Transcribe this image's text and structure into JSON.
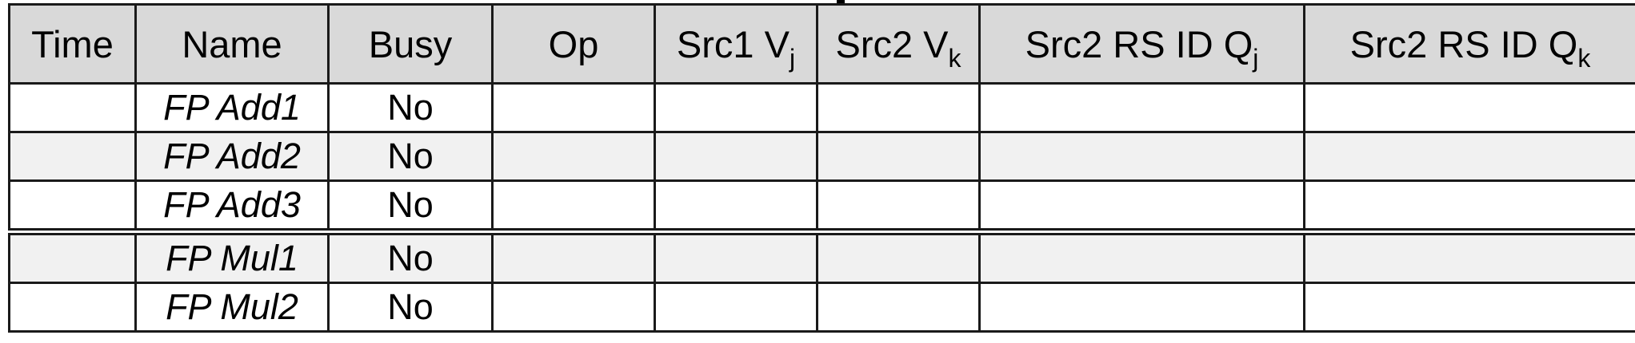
{
  "table": {
    "headers": [
      {
        "main": "Time",
        "sub": ""
      },
      {
        "main": "Name",
        "sub": ""
      },
      {
        "main": "Busy",
        "sub": ""
      },
      {
        "main": "Op",
        "sub": ""
      },
      {
        "main": "Src1 V",
        "sub": "j"
      },
      {
        "main": "Src2 V",
        "sub": "k"
      },
      {
        "main": "Src2 RS ID Q",
        "sub": "j"
      },
      {
        "main": "Src2 RS ID Q",
        "sub": "k"
      }
    ],
    "rows": [
      {
        "time": "",
        "name": "FP Add1",
        "busy": "No",
        "op": "",
        "vj": "",
        "vk": "",
        "qj": "",
        "qk": ""
      },
      {
        "time": "",
        "name": "FP Add2",
        "busy": "No",
        "op": "",
        "vj": "",
        "vk": "",
        "qj": "",
        "qk": ""
      },
      {
        "time": "",
        "name": "FP Add3",
        "busy": "No",
        "op": "",
        "vj": "",
        "vk": "",
        "qj": "",
        "qk": ""
      },
      {
        "time": "",
        "name": "FP Mul1",
        "busy": "No",
        "op": "",
        "vj": "",
        "vk": "",
        "qj": "",
        "qk": ""
      },
      {
        "time": "",
        "name": "FP Mul2",
        "busy": "No",
        "op": "",
        "vj": "",
        "vk": "",
        "qj": "",
        "qk": ""
      }
    ]
  }
}
